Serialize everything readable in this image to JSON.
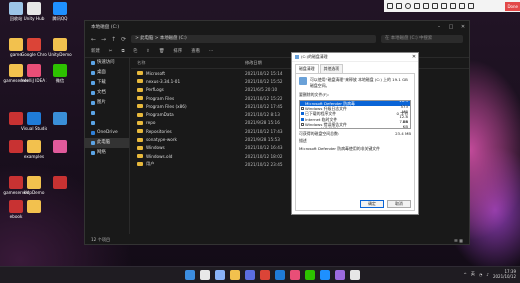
{
  "desktop": {
    "icons": [
      {
        "label": "回收站",
        "color": "#9cc5e8"
      },
      {
        "label": "Unity Hub",
        "color": "#e6e6e6"
      },
      {
        "label": "腾讯QQ",
        "color": "#1e90ff"
      },
      {
        "label": "game",
        "color": "#f2c14e"
      },
      {
        "label": "Google Chrome",
        "color": "#db4437"
      },
      {
        "label": "UnityDemo",
        "color": "#f2c14e"
      },
      {
        "label": "gameserver",
        "color": "#f2c14e"
      },
      {
        "label": "IntelliJ IDEA 2021.2",
        "color": "#e94e77"
      },
      {
        "label": "微信",
        "color": "#2dc100"
      },
      {
        "label": "",
        "color": "#c83232"
      },
      {
        "label": "Visual Studio Code",
        "color": "#1f7bd8"
      },
      {
        "label": "",
        "color": "#3a8fd8"
      },
      {
        "label": "",
        "color": "#c83232"
      },
      {
        "label": "examples",
        "color": "#f2c14e"
      },
      {
        "label": "",
        "color": "#e05a9b"
      },
      {
        "label": "gameserver",
        "color": "#c83232"
      },
      {
        "label": "UdpDemo",
        "color": "#f2c14e"
      },
      {
        "label": "",
        "color": "#c83232"
      },
      {
        "label": "ebook",
        "color": "#c83232"
      },
      {
        "label": "",
        "color": "#f2c14e"
      }
    ]
  },
  "snip_toolbar": {
    "done_label": "Done"
  },
  "explorer": {
    "title": "本地磁盘 (C:)",
    "address": "> 此电脑 > 本地磁盘 (C:)",
    "search_placeholder": "在 本地磁盘 (C:) 中搜索",
    "commands": [
      "新建",
      "✂",
      "⧉",
      "⎘",
      "⇪",
      "🗑",
      "排序",
      "查看",
      "···"
    ],
    "sidebar": [
      {
        "label": "快速访问",
        "color": "#5ba4e6",
        "selected": false
      },
      {
        "label": "桌面",
        "color": "#5ba4e6",
        "selected": false
      },
      {
        "label": "下载",
        "color": "#5ba4e6",
        "selected": false
      },
      {
        "label": "文档",
        "color": "#5ba4e6",
        "selected": false
      },
      {
        "label": "图片",
        "color": "#5ba4e6",
        "selected": false
      },
      {
        "label": "",
        "color": "#5ba4e6",
        "selected": false
      },
      {
        "label": "",
        "color": "#5ba4e6",
        "selected": false
      },
      {
        "label": "OneDrive",
        "color": "#2f7fd8",
        "selected": false
      },
      {
        "label": "此电脑",
        "color": "#5ba4e6",
        "selected": true
      },
      {
        "label": "网络",
        "color": "#5ba4e6",
        "selected": false
      }
    ],
    "columns": {
      "name": "名称",
      "date": "修改日期",
      "type": "类型"
    },
    "files": [
      {
        "name": "Microsoft",
        "date": "2021/10/12 15:14",
        "type": "文件夹",
        "kind": "folder"
      },
      {
        "name": "nexus-3.34.1-01",
        "date": "2021/10/12 15:52",
        "type": "文件夹",
        "kind": "folder"
      },
      {
        "name": "PerfLogs",
        "date": "2021/6/5 20:10",
        "type": "文件夹",
        "kind": "folder"
      },
      {
        "name": "Program Files",
        "date": "2021/10/12 15:22",
        "type": "文件夹",
        "kind": "folder"
      },
      {
        "name": "Program Files (x86)",
        "date": "2021/10/12 17:45",
        "type": "文件夹",
        "kind": "folder"
      },
      {
        "name": "ProgramData",
        "date": "2021/10/12 8:13",
        "type": "文件夹",
        "kind": "folder"
      },
      {
        "name": "repo",
        "date": "2021/9/28 15:16",
        "type": "文件夹",
        "kind": "folder"
      },
      {
        "name": "Repositories",
        "date": "2021/10/12 17:43",
        "type": "文件夹",
        "kind": "folder"
      },
      {
        "name": "sonatype-work",
        "date": "2021/9/28 15:53",
        "type": "文件夹",
        "kind": "folder"
      },
      {
        "name": "Windows",
        "date": "2021/10/12 16:43",
        "type": "文件夹",
        "kind": "folder"
      },
      {
        "name": "Windows.old",
        "date": "2021/10/12 18:02",
        "type": "文件夹",
        "kind": "folder"
      },
      {
        "name": "用户",
        "date": "2021/10/12 23:45",
        "type": "文件夹",
        "kind": "folder"
      }
    ],
    "status": "12 个项目",
    "view_icons": "☰ ▦"
  },
  "dialog": {
    "title": "(C:)的磁盘清理",
    "tabs": [
      "磁盘清理",
      "其他选项"
    ],
    "description": "可以使用“磁盘清理”来释放 本地磁盘 (C:) 上的 19.1 GB 磁盘空间。",
    "list_label": "要删除的文件(F):",
    "items": [
      {
        "name": "Microsoft Defender 防病毒",
        "size": "20.3 MB",
        "checked": true,
        "selected": true
      },
      {
        "name": "Windows 升级日志文件",
        "size": "573 MB",
        "checked": false,
        "selected": false
      },
      {
        "name": "已下载的程序文件",
        "size": "0 字节",
        "checked": true,
        "selected": false
      },
      {
        "name": "Internet 临时文件",
        "size": "12.8 KB",
        "checked": true,
        "selected": false
      },
      {
        "name": "Windows 错误报告文件",
        "size": "7.26 KB",
        "checked": false,
        "selected": false
      },
      {
        "name": "DirectX 着色器缓存",
        "size": "290 KB",
        "checked": false,
        "selected": false
      }
    ],
    "total_label": "可获得的磁盘空间总数:",
    "total_value": "23.4 MB",
    "desc_heading": "描述",
    "desc_text": "Microsoft Defender 防病毒使用的非关键文件",
    "ok_label": "确定",
    "cancel_label": "取消"
  },
  "taskbar": {
    "time": "17:39",
    "date": "2021/10/12",
    "lang": "英",
    "apps": [
      {
        "color": "#3c8de0"
      },
      {
        "color": "#e8e8e8"
      },
      {
        "color": "#8ab4f8"
      },
      {
        "color": "#f2c14e"
      },
      {
        "color": "#5b6ee1"
      },
      {
        "color": "#db4437"
      },
      {
        "color": "#1f7bd8"
      },
      {
        "color": "#e94e77"
      },
      {
        "color": "#2dc100"
      },
      {
        "color": "#1e90ff"
      },
      {
        "color": "#9c6ade"
      },
      {
        "color": "#e6e6e6"
      }
    ]
  }
}
